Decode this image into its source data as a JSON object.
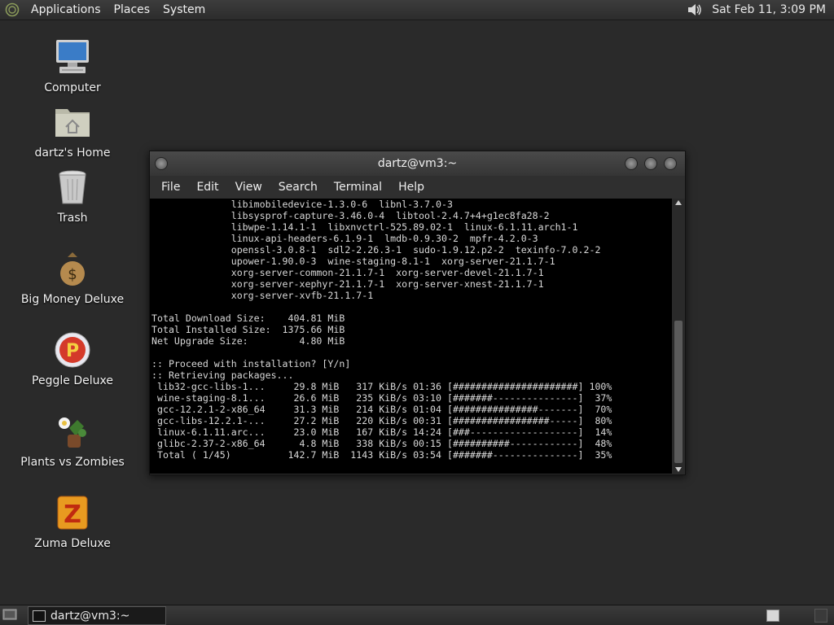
{
  "top_panel": {
    "menus": [
      "Applications",
      "Places",
      "System"
    ],
    "clock": "Sat Feb 11,  3:09 PM"
  },
  "desktop_icons": [
    {
      "label": "Computer",
      "icon": "computer-icon"
    },
    {
      "label": "dartz's Home",
      "icon": "home-folder-icon"
    },
    {
      "label": "Trash",
      "icon": "trash-icon"
    },
    {
      "label": "Big Money Deluxe",
      "icon": "money-bag-icon"
    },
    {
      "label": "Peggle Deluxe",
      "icon": "peggle-icon"
    },
    {
      "label": "Plants vs Zombies",
      "icon": "plants-vs-zombies-icon"
    },
    {
      "label": "Zuma Deluxe",
      "icon": "zuma-icon"
    }
  ],
  "terminal": {
    "title": "dartz@vm3:~",
    "menus": [
      "File",
      "Edit",
      "View",
      "Search",
      "Terminal",
      "Help"
    ],
    "lines": [
      "              libimobiledevice-1.3.0-6  libnl-3.7.0-3",
      "              libsysprof-capture-3.46.0-4  libtool-2.4.7+4+g1ec8fa28-2",
      "              libwpe-1.14.1-1  libxnvctrl-525.89.02-1  linux-6.1.11.arch1-1",
      "              linux-api-headers-6.1.9-1  lmdb-0.9.30-2  mpfr-4.2.0-3",
      "              openssl-3.0.8-1  sdl2-2.26.3-1  sudo-1.9.12.p2-2  texinfo-7.0.2-2",
      "              upower-1.90.0-3  wine-staging-8.1-1  xorg-server-21.1.7-1",
      "              xorg-server-common-21.1.7-1  xorg-server-devel-21.1.7-1",
      "              xorg-server-xephyr-21.1.7-1  xorg-server-xnest-21.1.7-1",
      "              xorg-server-xvfb-21.1.7-1",
      "",
      "Total Download Size:    404.81 MiB",
      "Total Installed Size:  1375.66 MiB",
      "Net Upgrade Size:         4.80 MiB",
      "",
      ":: Proceed with installation? [Y/n]",
      ":: Retrieving packages...",
      " lib32-gcc-libs-1...     29.8 MiB   317 KiB/s 01:36 [######################] 100%",
      " wine-staging-8.1...     26.6 MiB   235 KiB/s 03:10 [#######---------------]  37%",
      " gcc-12.2.1-2-x86_64     31.3 MiB   214 KiB/s 01:04 [###############-------]  70%",
      " gcc-libs-12.2.1-...     27.2 MiB   220 KiB/s 00:31 [#################-----]  80%",
      " linux-6.1.11.arc...     23.0 MiB   167 KiB/s 14:24 [###-------------------]  14%",
      " glibc-2.37-2-x86_64      4.8 MiB   338 KiB/s 00:15 [##########------------]  48%",
      " Total ( 1/45)          142.7 MiB  1143 KiB/s 03:54 [#######---------------]  35%"
    ]
  },
  "taskbar": {
    "task_label": "dartz@vm3:~"
  }
}
